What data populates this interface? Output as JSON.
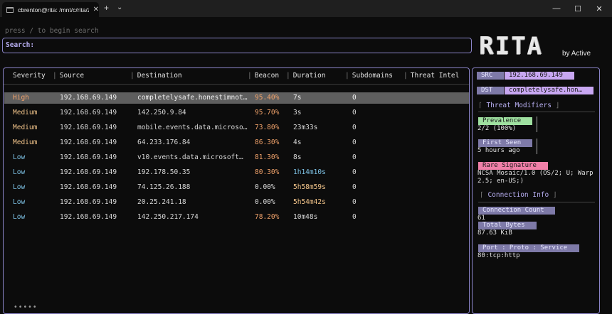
{
  "window": {
    "tab_title": "cbrenton@rita: /mnt/c/rita/ze",
    "tab_close": "✕",
    "new_tab": "+",
    "dropdown": "⌄",
    "minimize": "—",
    "maximize": "☐",
    "close": "✕"
  },
  "search": {
    "hint": "press / to begin search",
    "label": "Search:",
    "value": ""
  },
  "logo": {
    "text": "RITA",
    "sub": "by Active"
  },
  "table": {
    "columns": [
      "Severity",
      "Source",
      "Destination",
      "Beacon",
      "Duration",
      "Subdomains",
      "Threat Intel"
    ],
    "rows": [
      {
        "severity": "High",
        "source": "192.168.69.149",
        "destination": "completelysafe.honestimnot…",
        "beacon": "95.40%",
        "duration": "7s",
        "subdomains": "0",
        "threat_intel": ""
      },
      {
        "severity": "Medium",
        "source": "192.168.69.149",
        "destination": "142.250.9.84",
        "beacon": "95.70%",
        "duration": "3s",
        "subdomains": "0",
        "threat_intel": ""
      },
      {
        "severity": "Medium",
        "source": "192.168.69.149",
        "destination": "mobile.events.data.microso…",
        "beacon": "73.80%",
        "duration": "23m33s",
        "subdomains": "0",
        "threat_intel": ""
      },
      {
        "severity": "Medium",
        "source": "192.168.69.149",
        "destination": "64.233.176.84",
        "beacon": "86.30%",
        "duration": "4s",
        "subdomains": "0",
        "threat_intel": ""
      },
      {
        "severity": "Low",
        "source": "192.168.69.149",
        "destination": "v10.events.data.microsoft…",
        "beacon": "81.30%",
        "duration": "8s",
        "subdomains": "0",
        "threat_intel": ""
      },
      {
        "severity": "Low",
        "source": "192.168.69.149",
        "destination": "192.178.50.35",
        "beacon": "80.30%",
        "duration": "1h14m10s",
        "subdomains": "0",
        "threat_intel": ""
      },
      {
        "severity": "Low",
        "source": "192.168.69.149",
        "destination": "74.125.26.188",
        "beacon": "0.00%",
        "duration": "5h58m59s",
        "subdomains": "0",
        "threat_intel": ""
      },
      {
        "severity": "Low",
        "source": "192.168.69.149",
        "destination": "20.25.241.18",
        "beacon": "0.00%",
        "duration": "5h54m42s",
        "subdomains": "0",
        "threat_intel": ""
      },
      {
        "severity": "Low",
        "source": "192.168.69.149",
        "destination": "142.250.217.174",
        "beacon": "78.20%",
        "duration": "10m48s",
        "subdomains": "0",
        "threat_intel": ""
      }
    ],
    "pager": "•••••"
  },
  "details": {
    "src_label": "SRC",
    "src_value": "192.168.69.149",
    "dst_label": "DST",
    "dst_value": "completelysafe.hon…",
    "threat_modifiers_title": "Threat Modifiers",
    "prevalence_label": "Prevalence",
    "prevalence_value": "2/2 (100%)",
    "first_seen_label": "First Seen",
    "first_seen_value": "5 hours ago",
    "rare_signature_label": "Rare Signature",
    "rare_signature_line1": "NCSA Mosaic/1.0 (OS/2; U; Warp",
    "rare_signature_line2": "2.5; en-US;)",
    "connection_info_title": "Connection Info",
    "connection_count_label": "Connection Count",
    "connection_count_value": "61",
    "total_bytes_label": "Total Bytes",
    "total_bytes_value": "87.63 KiB",
    "port_label": "Port : Proto : Service",
    "port_value": "80:tcp:http"
  },
  "colors": {
    "high": "#f2a36b",
    "medium": "#f2c48a",
    "low": "#7ec3e6",
    "beacon_high": "#f2a36b",
    "duration_hot": "#f2c48a",
    "duration_warm": "#7ec3e6",
    "accent": "#8a84c8",
    "chip_src": "#c8a7f2",
    "chip_label": "#7e7aa8",
    "chip_green": "#9fe0a0",
    "chip_pink": "#f07fa8"
  }
}
